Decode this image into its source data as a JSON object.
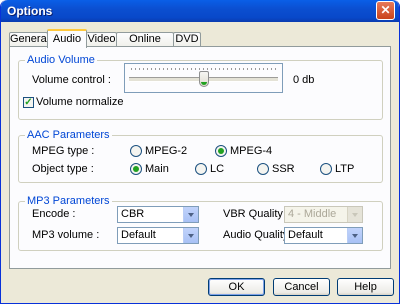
{
  "window": {
    "title": "Options",
    "close_glyph": "✕"
  },
  "tabs": [
    {
      "label": "General",
      "active": false
    },
    {
      "label": "Audio",
      "active": true
    },
    {
      "label": "Video",
      "active": false
    },
    {
      "label": "Online Video",
      "active": false
    },
    {
      "label": "DVD",
      "active": false
    }
  ],
  "audio_volume": {
    "group_title": "Audio Volume",
    "volume_label": "Volume control :",
    "volume_value_text": "0 db",
    "volume_level_fraction": 0.5,
    "normalize_label": "Volume normalize",
    "normalize_checked": true,
    "check_glyph": "✓"
  },
  "aac": {
    "group_title": "AAC Parameters",
    "mpeg_type_label": "MPEG type :",
    "mpeg_options": [
      {
        "label": "MPEG-2",
        "checked": false
      },
      {
        "label": "MPEG-4",
        "checked": true
      }
    ],
    "object_type_label": "Object type :",
    "object_options": [
      {
        "label": "Main",
        "checked": true
      },
      {
        "label": "LC",
        "checked": false
      },
      {
        "label": "SSR",
        "checked": false
      },
      {
        "label": "LTP",
        "checked": false
      }
    ]
  },
  "mp3": {
    "group_title": "MP3 Parameters",
    "encode_label": "Encode :",
    "encode_value": "CBR",
    "mp3_volume_label": "MP3 volume :",
    "mp3_volume_value": "Default",
    "vbr_quality_label": "VBR Quality :",
    "vbr_quality_value": "4 - Middle",
    "vbr_quality_enabled": false,
    "audio_quality_label": "Audio Quality :",
    "audio_quality_value": "Default"
  },
  "buttons": {
    "ok": "OK",
    "cancel": "Cancel",
    "help": "Help"
  },
  "colors": {
    "accent": "#0046d5",
    "check": "#21a121",
    "titlebar": "#0b4fd1"
  }
}
